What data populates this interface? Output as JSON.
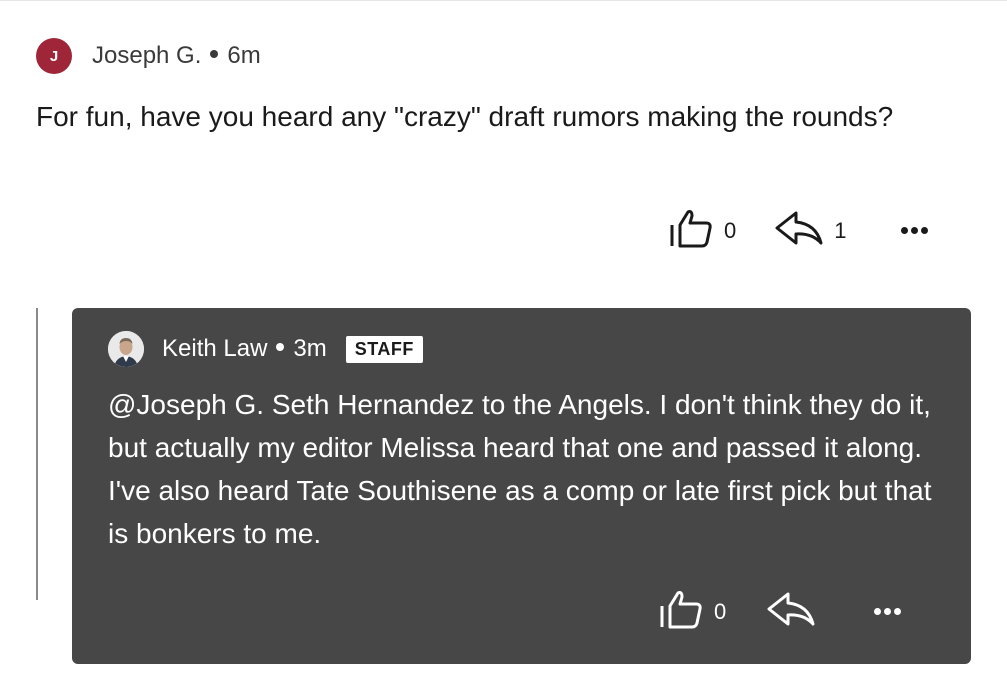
{
  "parent_comment": {
    "avatar_initial": "J",
    "author": "Joseph G.",
    "time": "6m",
    "body": "For fun, have you heard any \"crazy\" draft rumors making the rounds?",
    "like_count": "0",
    "reply_count": "1",
    "icons": {
      "like": "thumbs-up-icon",
      "reply": "reply-arrow-icon",
      "more": "more-dots-icon"
    }
  },
  "reply_comment": {
    "author": "Keith Law",
    "time": "3m",
    "badge": "STAFF",
    "body": "@Joseph G. Seth Hernandez to the Angels. I don't think they do it, but actually my editor Melissa heard that one and passed it along. I've also heard Tate Southisene as a comp or late first pick but that is bonkers to me.",
    "like_count": "0",
    "icons": {
      "avatar": "profile-photo",
      "like": "thumbs-up-icon",
      "reply": "reply-arrow-icon",
      "more": "more-dots-icon"
    }
  },
  "colors": {
    "avatar_bg": "#9e2638",
    "reply_bg": "#474747",
    "thread_line": "#8a8a8a"
  }
}
